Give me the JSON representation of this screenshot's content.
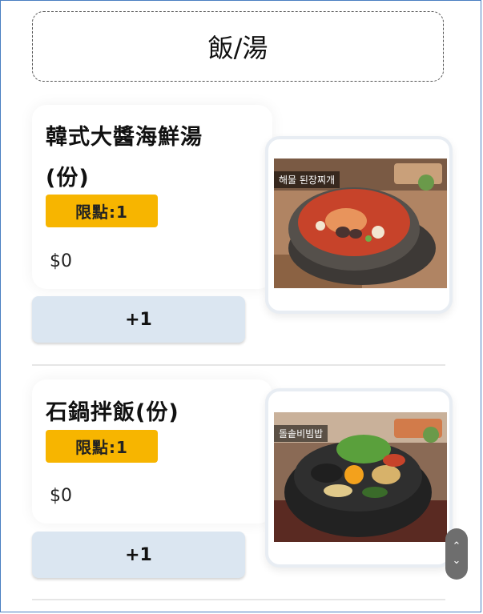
{
  "category": {
    "title": "飯/湯"
  },
  "items": [
    {
      "name_line1": "韓式大醬海鮮湯",
      "name_line2": "(份)",
      "limit_badge": "限點:1",
      "price": "$0",
      "add_label": "+1",
      "photo_caption": "해물 된장찌개",
      "photo_icon": "doenjang-stew-photo"
    },
    {
      "name_line1": "石鍋拌飯(份)",
      "limit_badge": "限點:1",
      "price": "$0",
      "add_label": "+1",
      "photo_caption": "돌솥비빔밥",
      "photo_icon": "bibimbap-photo"
    }
  ],
  "scroll": {
    "up_icon": "chevron-up-icon",
    "down_icon": "chevron-down-icon",
    "up_glyph": "⌃",
    "down_glyph": "⌄"
  },
  "colors": {
    "badge": "#f7b500",
    "button": "#dbe6f1",
    "frame": "#4a7fc1"
  }
}
